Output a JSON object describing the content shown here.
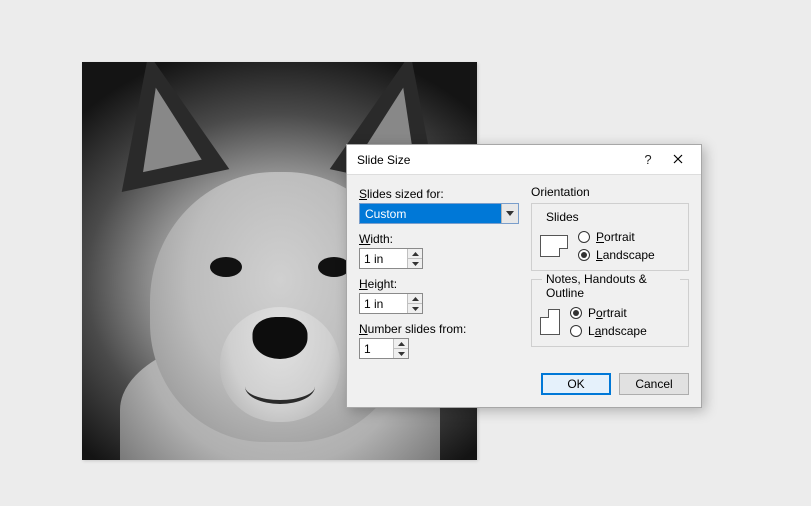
{
  "dialog": {
    "title": "Slide Size",
    "slides_sized_for_label": "Slides sized for:",
    "slides_sized_for_value": "Custom",
    "width_label": "Width:",
    "width_value": "1 in",
    "height_label": "Height:",
    "height_value": "1 in",
    "number_from_label": "Number slides from:",
    "number_from_value": "1",
    "orientation_label": "Orientation",
    "slides_group_label": "Slides",
    "slides_portrait": "Portrait",
    "slides_landscape": "Landscape",
    "slides_selected": "Landscape",
    "notes_group_label": "Notes, Handouts & Outline",
    "notes_portrait": "Portrait",
    "notes_landscape": "Landscape",
    "notes_selected": "Portrait",
    "ok_label": "OK",
    "cancel_label": "Cancel",
    "help_symbol": "?"
  }
}
